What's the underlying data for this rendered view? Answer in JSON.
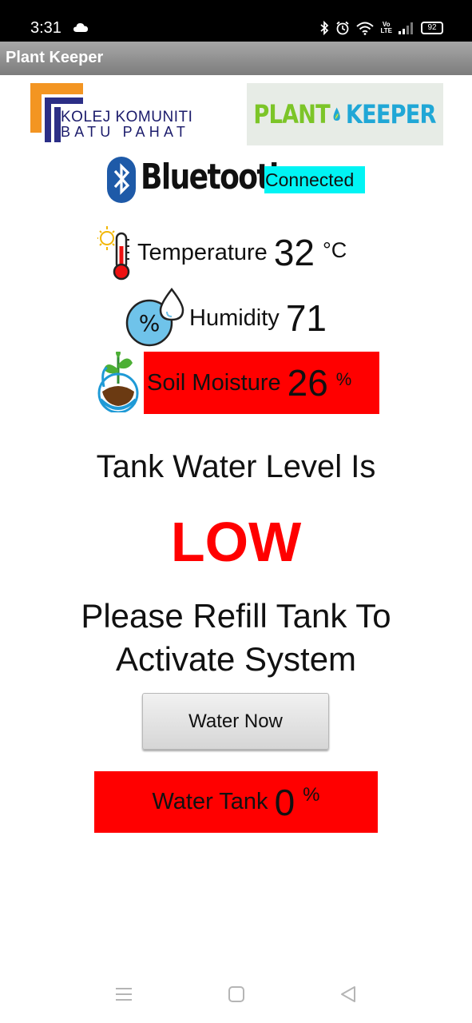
{
  "status_bar": {
    "time": "3:31",
    "battery": "92",
    "network_label_top": "Vo",
    "network_label_bottom": "LTE"
  },
  "app_bar": {
    "title": "Plant Keeper"
  },
  "logos": {
    "college_line1": "KOLEJ KOMUNITI",
    "college_line2": "BATU PAHAT",
    "app_logo_part1": "PLANT",
    "app_logo_part2": "KEEPER"
  },
  "bluetooth": {
    "label": "Bluetooth",
    "status": "Connected",
    "status_color": "#00f4f4"
  },
  "sensors": {
    "temperature": {
      "label": "Temperature",
      "value": "32",
      "unit": "°C"
    },
    "humidity": {
      "label": "Humidity",
      "value": "71"
    },
    "soil_moisture": {
      "label": "Soil Moisture",
      "value": "26",
      "unit": "%",
      "bg_color": "#ff0000"
    }
  },
  "tank": {
    "title": "Tank Water Level Is",
    "level": "LOW",
    "level_color": "#ff0000",
    "message_line1": "Please Refill Tank To",
    "message_line2": "Activate System",
    "water_button_label": "Water Now",
    "water_tank_label": "Water Tank",
    "water_tank_value": "0",
    "water_tank_unit": "%",
    "water_tank_bg": "#ff0000"
  },
  "nav_bar": {
    "icons": [
      "menu-icon",
      "home-square-icon",
      "back-triangle-icon"
    ]
  }
}
